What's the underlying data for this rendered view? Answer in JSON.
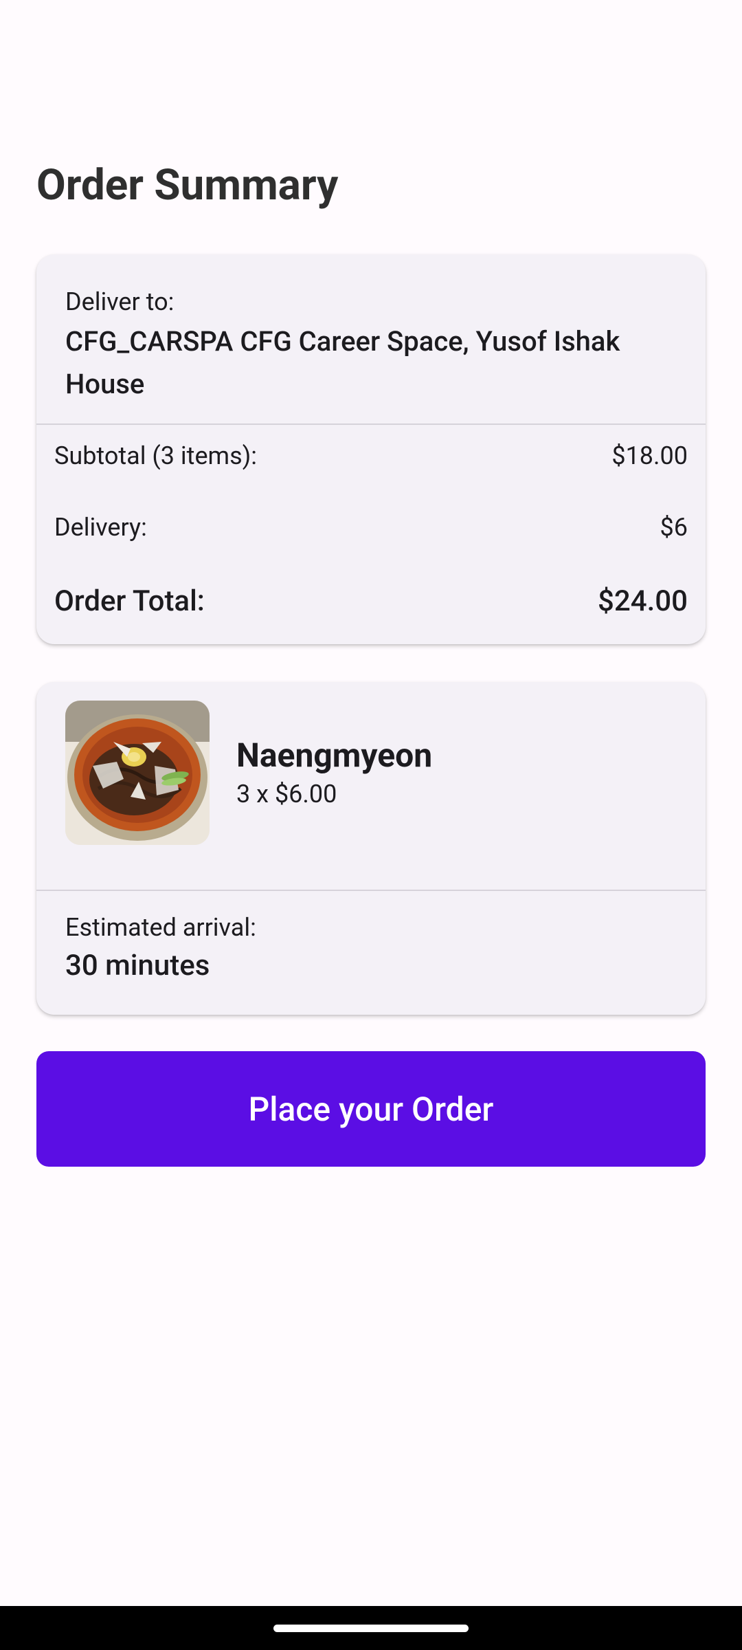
{
  "header": {
    "title": "Order Summary"
  },
  "delivery": {
    "label": "Deliver to:",
    "address": "CFG_CARSPA CFG Career Space, Yusof Ishak House"
  },
  "summary": {
    "subtotal_label": "Subtotal (3 items):",
    "subtotal_value": "$18.00",
    "delivery_label": "Delivery:",
    "delivery_value": "$6",
    "total_label": "Order Total:",
    "total_value": "$24.00"
  },
  "item": {
    "name": "Naengmyeon",
    "quantity_price": "3 x $6.00",
    "image_icon": "food-photo"
  },
  "eta": {
    "label": "Estimated arrival:",
    "value": "30 minutes"
  },
  "actions": {
    "place_order_label": "Place your Order"
  },
  "colors": {
    "primary": "#5b0ee4",
    "card_background": "#f4f1f7",
    "page_background": "#fffbfe"
  }
}
